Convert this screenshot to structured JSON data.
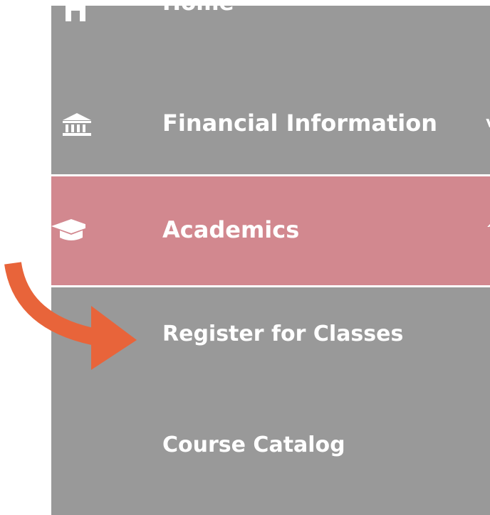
{
  "sidebar": {
    "items": [
      {
        "label": "Home",
        "icon": "home-icon"
      },
      {
        "label": "Financial Information",
        "icon": "bank-icon",
        "expandable": true
      },
      {
        "label": "Academics",
        "icon": "graduation-cap-icon",
        "expanded": true,
        "active": true
      },
      {
        "label": "Register for Classes",
        "icon": "",
        "submenu": true
      },
      {
        "label": "Course Catalog",
        "icon": "",
        "submenu": true
      }
    ]
  },
  "colors": {
    "sidebar_bg": "#999999",
    "active_bg": "#d2888f",
    "text": "#ffffff",
    "arrow": "#e8643a"
  },
  "annotation": {
    "arrow_icon": "curved-arrow-icon",
    "points_to": "Register for Classes"
  }
}
